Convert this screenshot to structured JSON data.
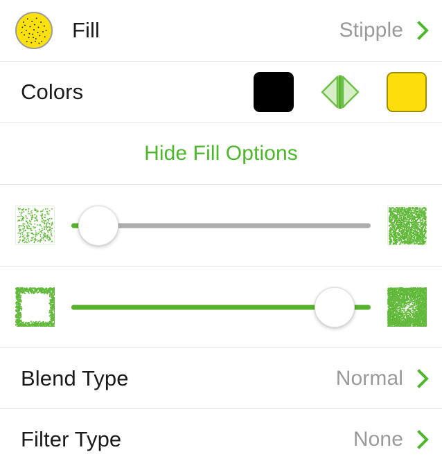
{
  "header": {
    "swatch_name": "fill-preview-swatch",
    "swatch_color": "#fbe10c",
    "swatch_border_color": "#9b9b9b",
    "title": "Fill",
    "value": "Stipple",
    "chevron": "chevron-right-icon"
  },
  "colors": {
    "label": "Colors",
    "primary_color": "#000000",
    "secondary_color": "#fbdf0c",
    "swap_icon": "swap-colors-icon",
    "accent": "#6ebe4a"
  },
  "toggle": {
    "label": "Hide Fill Options",
    "color": "#4cb72b"
  },
  "sliders": [
    {
      "name": "density-slider",
      "left_preview": "sparse-stipple-preview",
      "right_preview": "dense-stipple-preview",
      "value_percent": 9,
      "track_color": "#aeaeae",
      "fill_color": "#57b22e",
      "thumb_color": "#ffffff"
    },
    {
      "name": "spread-slider",
      "left_preview": "narrow-spread-preview",
      "right_preview": "wide-spread-preview",
      "value_percent": 88,
      "track_color": "#57b22e",
      "fill_color": "#57b22e",
      "thumb_color": "#ffffff"
    }
  ],
  "options": [
    {
      "name": "blend-type",
      "label": "Blend Type",
      "value": "Normal",
      "chevron": "chevron-right-icon"
    },
    {
      "name": "filter-type",
      "label": "Filter Type",
      "value": "None",
      "chevron": "chevron-right-icon"
    }
  ]
}
